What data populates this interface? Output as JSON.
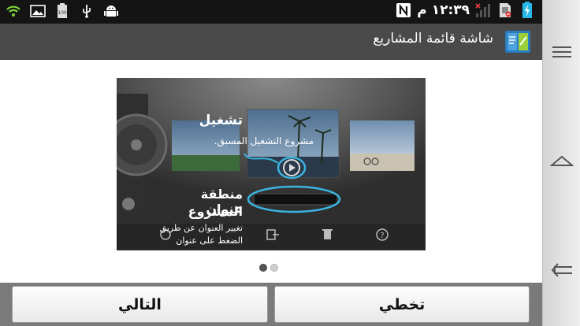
{
  "status_bar": {
    "clock": "١٢:٣٩ م",
    "left_icons": [
      "wifi-icon",
      "image-icon",
      "battery-100-icon",
      "usb-icon",
      "android-icon"
    ],
    "right_icons": [
      "nfc-icon",
      "no-signal-icon",
      "sim-icon",
      "battery-charging-icon"
    ]
  },
  "title_bar": {
    "title": "شاشة قائمة المشاريع",
    "icon": "project-list-app-icon"
  },
  "illustration": {
    "play_heading": "تشغيل",
    "play_desc": "مشروع التشغيل المسبق.",
    "title_area_heading_line1": "منطقة عنوان",
    "title_area_heading_line2": "المشروع",
    "title_area_desc_line1": "تغيير العنوان عن طريق",
    "title_area_desc_line2": "الضغط على عنوان"
  },
  "pager": {
    "total": 2,
    "active": 0
  },
  "buttons": {
    "next": "التالي",
    "skip": "تخطي"
  },
  "nav": [
    "menu-icon",
    "home-icon",
    "back-icon"
  ]
}
